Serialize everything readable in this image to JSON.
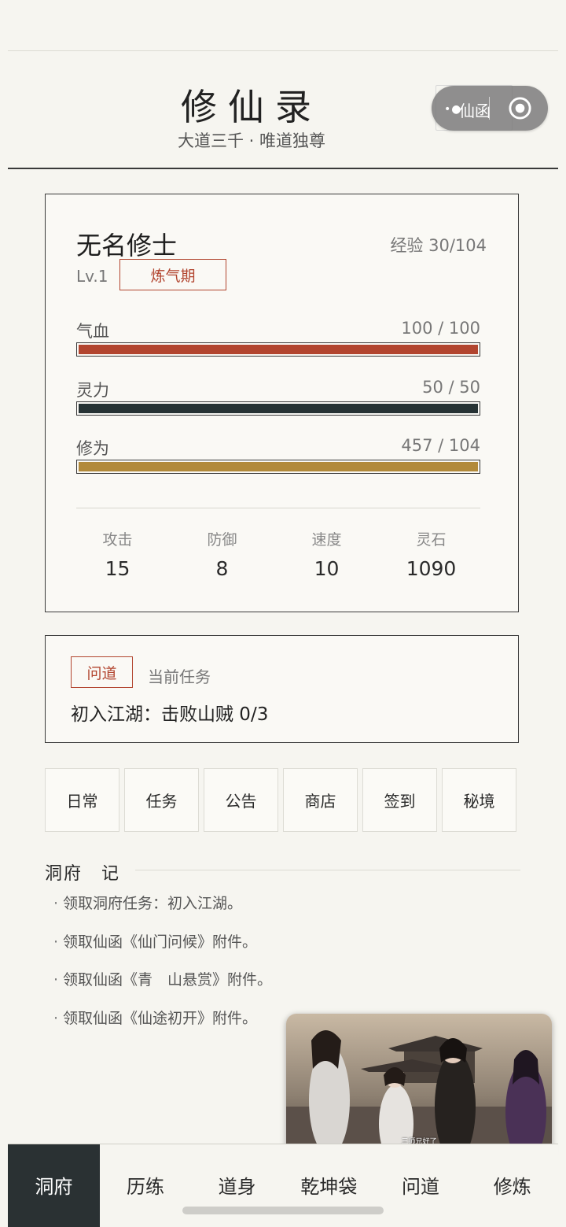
{
  "header": {
    "title": "修仙录",
    "subtitle": "大道三千 · 唯道独尊"
  },
  "capsule": {
    "label": "仙函",
    "menu_icon": "dots-icon",
    "close_icon": "target-icon"
  },
  "profile": {
    "name": "无名修士",
    "exp_label": "经验 30/104",
    "level": "Lv.1",
    "realm": "炼气期",
    "stats": [
      {
        "label": "气血",
        "value": "100 / 100",
        "fraction": 1.0,
        "color": "#b2452f"
      },
      {
        "label": "灵力",
        "value": "50 / 50",
        "fraction": 1.0,
        "color": "#263234"
      },
      {
        "label": "修为",
        "value": "457 / 104",
        "fraction": 1.0,
        "color": "#b28a3a"
      }
    ],
    "attributes": [
      {
        "label": "攻击",
        "value": "15"
      },
      {
        "label": "防御",
        "value": "8"
      },
      {
        "label": "速度",
        "value": "10"
      },
      {
        "label": "灵石",
        "value": "1090"
      }
    ]
  },
  "quest": {
    "tag": "问道",
    "heading": "当前任务",
    "text": "初入江湖：击败山贼 0/3"
  },
  "menu": [
    "日常",
    "任务",
    "公告",
    "商店",
    "签到",
    "秘境"
  ],
  "log": {
    "title": "洞府　记",
    "items": [
      "领取洞府任务：初入江湖。",
      "领取仙函《仙门问候》附件。",
      "领取仙函《青　山悬赏》附件。",
      "领取仙函《仙途初开》附件。"
    ]
  },
  "video": {
    "subtitle": "三师兄好了"
  },
  "tabs": [
    {
      "label": "洞府",
      "active": true
    },
    {
      "label": "历练",
      "active": false
    },
    {
      "label": "道身",
      "active": false
    },
    {
      "label": "乾坤袋",
      "active": false
    },
    {
      "label": "问道",
      "active": false
    },
    {
      "label": "修炼",
      "active": false
    }
  ]
}
